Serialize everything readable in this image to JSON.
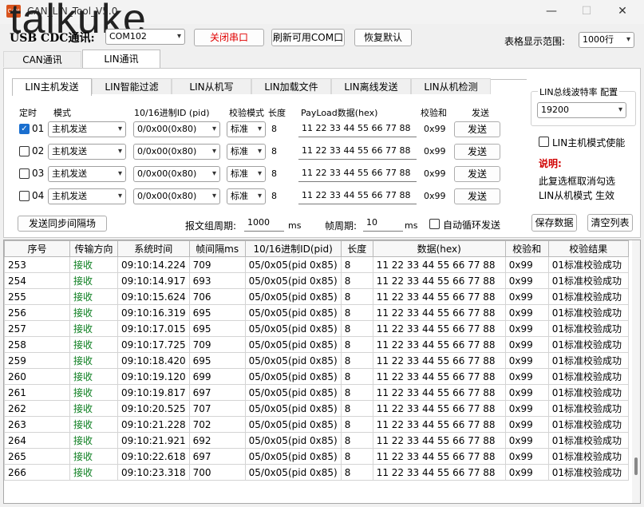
{
  "window": {
    "title": "CAN_LIN_Tool_V5.0",
    "min": "—",
    "max": "☐",
    "close": "✕",
    "app_icon": "CAN"
  },
  "watermark": "talkuke",
  "top": {
    "usb_label": "USB  CDC通讯:",
    "com_value": "COM102",
    "close_port": "关闭串口",
    "refresh_com": "刷新可用COM口",
    "restore_default": "恢复默认",
    "range_label": "表格显示范围:",
    "range_value": "1000行"
  },
  "main_tabs": [
    "CAN通讯",
    "LIN通讯"
  ],
  "sub_tabs": [
    "LIN主机发送",
    "LIN智能过滤",
    "LIN从机写",
    "LIN加载文件",
    "LIN离线发送",
    "LIN从机检测"
  ],
  "columns": {
    "timer": "定时",
    "mode": "模式",
    "id": "10/16进制ID (pid)",
    "check_mode": "校验模式",
    "len": "长度",
    "payload": "PayLoad数据(hex)",
    "checksum": "校验和",
    "send": "发送"
  },
  "send_rows": [
    {
      "checked": true,
      "num": "01",
      "mode": "主机发送",
      "id": "0/0x00(0x80)",
      "check": "标准",
      "len": "8",
      "payload": "11 22 33 44 55 66 77 88",
      "sum": "0x99",
      "btn": "发送"
    },
    {
      "checked": false,
      "num": "02",
      "mode": "主机发送",
      "id": "0/0x00(0x80)",
      "check": "标准",
      "len": "8",
      "payload": "11 22 33 44 55 66 77 88",
      "sum": "0x99",
      "btn": "发送"
    },
    {
      "checked": false,
      "num": "03",
      "mode": "主机发送",
      "id": "0/0x00(0x80)",
      "check": "标准",
      "len": "8",
      "payload": "11 22 33 44 55 66 77 88",
      "sum": "0x99",
      "btn": "发送"
    },
    {
      "checked": false,
      "num": "04",
      "mode": "主机发送",
      "id": "0/0x00(0x80)",
      "check": "标准",
      "len": "8",
      "payload": "11 22 33 44 55 66 77 88",
      "sum": "0x99",
      "btn": "发送"
    }
  ],
  "bottom": {
    "sync_btn": "发送同步间隔场",
    "group_period_label": "报文组周期:",
    "group_period_value": "1000",
    "group_unit": "ms",
    "frame_period_label": "帧周期:",
    "frame_period_value": "10",
    "frame_unit": "ms",
    "auto_loop": "自动循环发送"
  },
  "right": {
    "baud_label": "LIN总线波特率 配置",
    "baud_value": "19200",
    "master_enable": "LIN主机模式使能",
    "note_title": "说明:",
    "note_line1": "此复选框取消勾选",
    "note_line2": "LIN从机模式 生效",
    "save_btn": "保存数据",
    "clear_btn": "清空列表"
  },
  "log": {
    "headers": [
      "序号",
      "传输方向",
      "系统时间",
      "帧间隔ms",
      "10/16进制ID(pid)",
      "长度",
      "数据(hex)",
      "校验和",
      "校验结果"
    ],
    "rows": [
      [
        "253",
        "接收",
        "09:10:14.224",
        "709",
        "05/0x05(pid 0x85)",
        "8",
        "11 22 33 44 55 66 77 88",
        "0x99",
        "01标准校验成功"
      ],
      [
        "254",
        "接收",
        "09:10:14.917",
        "693",
        "05/0x05(pid 0x85)",
        "8",
        "11 22 33 44 55 66 77 88",
        "0x99",
        "01标准校验成功"
      ],
      [
        "255",
        "接收",
        "09:10:15.624",
        "706",
        "05/0x05(pid 0x85)",
        "8",
        "11 22 33 44 55 66 77 88",
        "0x99",
        "01标准校验成功"
      ],
      [
        "256",
        "接收",
        "09:10:16.319",
        "695",
        "05/0x05(pid 0x85)",
        "8",
        "11 22 33 44 55 66 77 88",
        "0x99",
        "01标准校验成功"
      ],
      [
        "257",
        "接收",
        "09:10:17.015",
        "695",
        "05/0x05(pid 0x85)",
        "8",
        "11 22 33 44 55 66 77 88",
        "0x99",
        "01标准校验成功"
      ],
      [
        "258",
        "接收",
        "09:10:17.725",
        "709",
        "05/0x05(pid 0x85)",
        "8",
        "11 22 33 44 55 66 77 88",
        "0x99",
        "01标准校验成功"
      ],
      [
        "259",
        "接收",
        "09:10:18.420",
        "695",
        "05/0x05(pid 0x85)",
        "8",
        "11 22 33 44 55 66 77 88",
        "0x99",
        "01标准校验成功"
      ],
      [
        "260",
        "接收",
        "09:10:19.120",
        "699",
        "05/0x05(pid 0x85)",
        "8",
        "11 22 33 44 55 66 77 88",
        "0x99",
        "01标准校验成功"
      ],
      [
        "261",
        "接收",
        "09:10:19.817",
        "697",
        "05/0x05(pid 0x85)",
        "8",
        "11 22 33 44 55 66 77 88",
        "0x99",
        "01标准校验成功"
      ],
      [
        "262",
        "接收",
        "09:10:20.525",
        "707",
        "05/0x05(pid 0x85)",
        "8",
        "11 22 33 44 55 66 77 88",
        "0x99",
        "01标准校验成功"
      ],
      [
        "263",
        "接收",
        "09:10:21.228",
        "702",
        "05/0x05(pid 0x85)",
        "8",
        "11 22 33 44 55 66 77 88",
        "0x99",
        "01标准校验成功"
      ],
      [
        "264",
        "接收",
        "09:10:21.921",
        "692",
        "05/0x05(pid 0x85)",
        "8",
        "11 22 33 44 55 66 77 88",
        "0x99",
        "01标准校验成功"
      ],
      [
        "265",
        "接收",
        "09:10:22.618",
        "697",
        "05/0x05(pid 0x85)",
        "8",
        "11 22 33 44 55 66 77 88",
        "0x99",
        "01标准校验成功"
      ],
      [
        "266",
        "接收",
        "09:10:23.318",
        "700",
        "05/0x05(pid 0x85)",
        "8",
        "11 22 33 44 55 66 77 88",
        "0x99",
        "01标准校验成功"
      ]
    ]
  },
  "colors": {
    "accent": "#1a6fcf",
    "receive_text": "#0a7d1e",
    "close_port_text": "#e00000",
    "note_title": "#d00000"
  }
}
